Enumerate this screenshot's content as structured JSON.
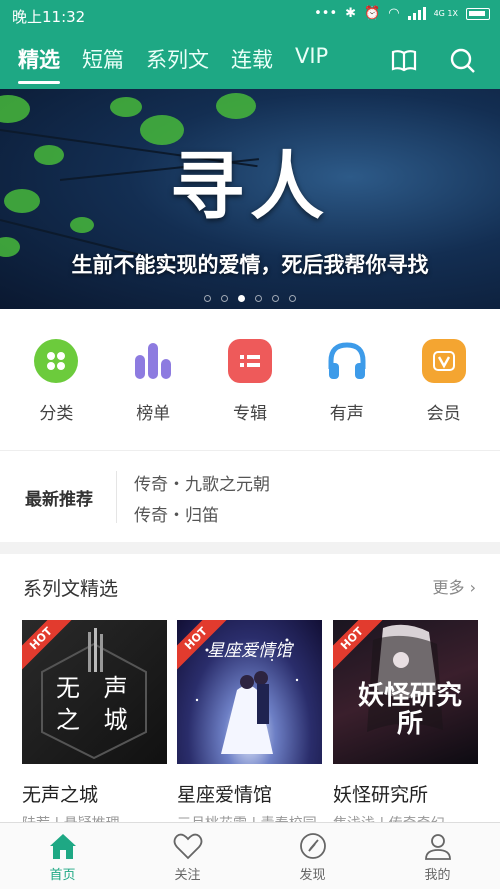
{
  "status": {
    "time": "晚上11:32",
    "network": "4G 1X"
  },
  "tabs": [
    {
      "label": "精选",
      "active": true
    },
    {
      "label": "短篇"
    },
    {
      "label": "系列文"
    },
    {
      "label": "连载"
    },
    {
      "label": "VIP"
    }
  ],
  "top_icons": [
    "book-icon",
    "search-icon"
  ],
  "banner": {
    "title": "寻人",
    "subtitle": "生前不能实现的爱情，死后我帮你寻找",
    "pages": 6,
    "active_page": 3
  },
  "categories": [
    {
      "label": "分类",
      "icon": "grid-icon",
      "color": "#6ccb3c"
    },
    {
      "label": "榜单",
      "icon": "chart-icon",
      "color": "#8d7be0"
    },
    {
      "label": "专辑",
      "icon": "album-icon",
      "color": "#ee5a5a"
    },
    {
      "label": "有声",
      "icon": "headphones-icon",
      "color": "#3d9be9"
    },
    {
      "label": "会员",
      "icon": "vip-icon",
      "color": "#f4a531"
    }
  ],
  "latest": {
    "heading": "最新推荐",
    "items": [
      "传奇・九歌之元朝",
      "传奇・归笛"
    ]
  },
  "series": {
    "title": "系列文精选",
    "more": "更多",
    "books": [
      {
        "name": "无声之城",
        "tag": "陆荐 | 悬疑推理",
        "hot": "HOT",
        "cover_text": "无 声 之 城"
      },
      {
        "name": "星座爱情馆",
        "tag": "三月桃花雪 | 青春校园",
        "hot": "HOT",
        "cover_text": "星座爱情馆"
      },
      {
        "name": "妖怪研究所",
        "tag": "焦浅浅 | 传奇奇幻",
        "hot": "HOT",
        "cover_text": "妖怪研究所"
      }
    ]
  },
  "bottom_nav": [
    {
      "label": "首页",
      "icon": "home-icon",
      "active": true
    },
    {
      "label": "关注",
      "icon": "heart-icon"
    },
    {
      "label": "发现",
      "icon": "compass-icon"
    },
    {
      "label": "我的",
      "icon": "user-icon"
    }
  ],
  "colors": {
    "accent": "#1ea884"
  }
}
